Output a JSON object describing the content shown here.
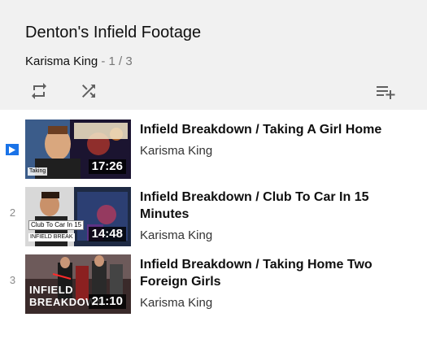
{
  "playlist": {
    "title": "Denton's Infield Footage",
    "owner": "Karisma King",
    "separator": " - ",
    "position": "1 / 3"
  },
  "controls": {
    "loop_icon": "loop-icon",
    "shuffle_icon": "shuffle-icon",
    "save_icon": "playlist-add-icon"
  },
  "colors": {
    "header_bg": "#f1f1f1",
    "now_playing": "#1a73e8"
  },
  "items": [
    {
      "index": "1",
      "now_playing": true,
      "title": "Infield Breakdown / Taking A Girl Home",
      "channel": "Karisma King",
      "duration": "17:26",
      "thumb_text": [
        "Taking"
      ]
    },
    {
      "index": "2",
      "now_playing": false,
      "title": "Infield Breakdown / Club To Car In 15 Minutes",
      "channel": "Karisma King",
      "duration": "14:48",
      "thumb_text": [
        "Club To Car In 15",
        "INFIELD BREAK"
      ]
    },
    {
      "index": "3",
      "now_playing": false,
      "title": "Infield Breakdown / Taking Home Two Foreign Girls",
      "channel": "Karisma King",
      "duration": "21:10",
      "thumb_text": [
        "INFIELD",
        "BREAKDOWN"
      ]
    }
  ]
}
